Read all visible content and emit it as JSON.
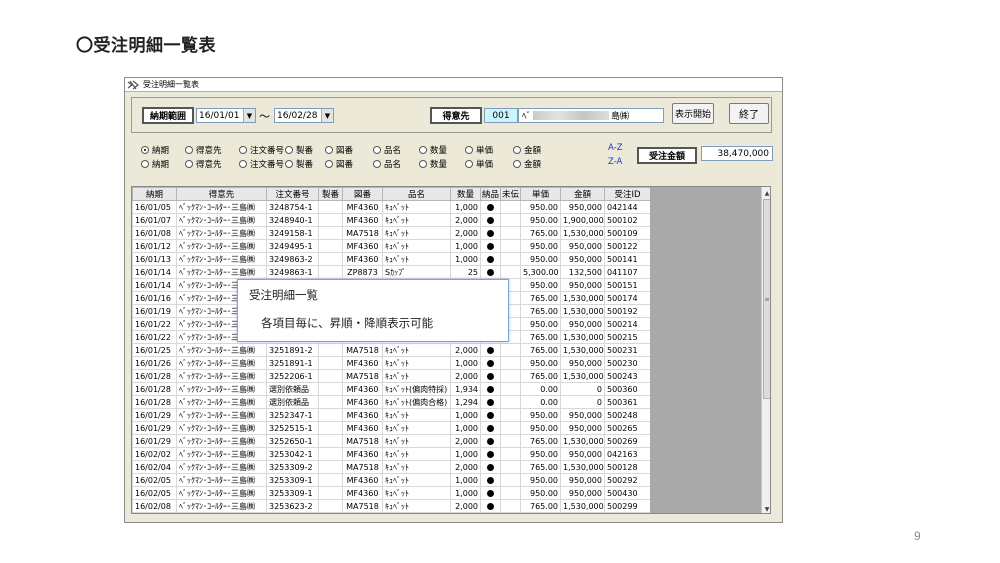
{
  "page": {
    "title": "〇受注明細一覧表",
    "page_number": "9"
  },
  "window": {
    "title": "受注明細一覧表"
  },
  "filter": {
    "period_label": "納期範囲",
    "date_from": "16/01/01",
    "tilde": "～",
    "date_to": "16/02/28",
    "customer_label": "得意先",
    "customer_code": "001",
    "customer_name_prefix": "ﾍﾞ",
    "customer_name_suffix": "島㈱",
    "show_button": "表示開始",
    "exit_button": "終了"
  },
  "sort": {
    "row1": [
      "納期",
      "得意先",
      "注文番号",
      "製番",
      "図番",
      "品名",
      "数量",
      "単価",
      "金額"
    ],
    "row2": [
      "納期",
      "得意先",
      "注文番号",
      "製番",
      "図番",
      "品名",
      "数量",
      "単価",
      "金額"
    ],
    "asc": "A-Z",
    "desc": "Z-A"
  },
  "total": {
    "label": "受注金額",
    "value": "38,470,000"
  },
  "grid": {
    "columns": [
      "納期",
      "得意先",
      "注文番号",
      "製番",
      "図番",
      "品名",
      "数量",
      "納品",
      "未伝",
      "単価",
      "金額",
      "受注ID"
    ],
    "rows": [
      [
        "16/01/05",
        "ﾍﾞｯｸﾏﾝ･ｺｰﾙﾀｰ･三島㈱",
        "3248754-1",
        "",
        "MF4360",
        "ｷｭﾍﾞｯﾄ",
        "1,000",
        "●",
        "",
        "950.00",
        "950,000",
        "042144"
      ],
      [
        "16/01/07",
        "ﾍﾞｯｸﾏﾝ･ｺｰﾙﾀｰ･三島㈱",
        "3248940-1",
        "",
        "MF4360",
        "ｷｭﾍﾞｯﾄ",
        "2,000",
        "●",
        "",
        "950.00",
        "1,900,000",
        "500102"
      ],
      [
        "16/01/08",
        "ﾍﾞｯｸﾏﾝ･ｺｰﾙﾀｰ･三島㈱",
        "3249158-1",
        "",
        "MA7518",
        "ｷｭﾍﾞｯﾄ",
        "2,000",
        "●",
        "",
        "765.00",
        "1,530,000",
        "500109"
      ],
      [
        "16/01/12",
        "ﾍﾞｯｸﾏﾝ･ｺｰﾙﾀｰ･三島㈱",
        "3249495-1",
        "",
        "MF4360",
        "ｷｭﾍﾞｯﾄ",
        "1,000",
        "●",
        "",
        "950.00",
        "950,000",
        "500122"
      ],
      [
        "16/01/13",
        "ﾍﾞｯｸﾏﾝ･ｺｰﾙﾀｰ･三島㈱",
        "3249863-2",
        "",
        "MF4360",
        "ｷｭﾍﾞｯﾄ",
        "1,000",
        "●",
        "",
        "950.00",
        "950,000",
        "500141"
      ],
      [
        "16/01/14",
        "ﾍﾞｯｸﾏﾝ･ｺｰﾙﾀｰ･三島㈱",
        "3249863-1",
        "",
        "ZP8873",
        "Sｶｯﾌﾟ",
        "25",
        "●",
        "",
        "5,300.00",
        "132,500",
        "041107"
      ],
      [
        "16/01/14",
        "ﾍﾞｯｸﾏﾝ･ｺｰﾙﾀｰ･三",
        "",
        "",
        "",
        "",
        "",
        "",
        "",
        "950.00",
        "950,000",
        "500151"
      ],
      [
        "16/01/16",
        "ﾍﾞｯｸﾏﾝ･ｺｰﾙﾀｰ･三",
        "",
        "",
        "",
        "",
        "",
        "",
        "",
        "765.00",
        "1,530,000",
        "500174"
      ],
      [
        "16/01/19",
        "ﾍﾞｯｸﾏﾝ･ｺｰﾙﾀｰ･三",
        "",
        "",
        "",
        "",
        "",
        "",
        "",
        "765.00",
        "1,530,000",
        "500192"
      ],
      [
        "16/01/22",
        "ﾍﾞｯｸﾏﾝ･ｺｰﾙﾀｰ･三",
        "",
        "",
        "",
        "",
        "",
        "",
        "",
        "950.00",
        "950,000",
        "500214"
      ],
      [
        "16/01/22",
        "ﾍﾞｯｸﾏﾝ･ｺｰﾙﾀｰ･三",
        "",
        "",
        "",
        "",
        "",
        "",
        "",
        "765.00",
        "1,530,000",
        "500215"
      ],
      [
        "16/01/25",
        "ﾍﾞｯｸﾏﾝ･ｺｰﾙﾀｰ･三島㈱",
        "3251891-2",
        "",
        "MA7518",
        "ｷｭﾍﾞｯﾄ",
        "2,000",
        "●",
        "",
        "765.00",
        "1,530,000",
        "500231"
      ],
      [
        "16/01/26",
        "ﾍﾞｯｸﾏﾝ･ｺｰﾙﾀｰ･三島㈱",
        "3251891-1",
        "",
        "MF4360",
        "ｷｭﾍﾞｯﾄ",
        "1,000",
        "●",
        "",
        "950.00",
        "950,000",
        "500230"
      ],
      [
        "16/01/28",
        "ﾍﾞｯｸﾏﾝ･ｺｰﾙﾀｰ･三島㈱",
        "3252206-1",
        "",
        "MA7518",
        "ｷｭﾍﾞｯﾄ",
        "2,000",
        "●",
        "",
        "765.00",
        "1,530,000",
        "500243"
      ],
      [
        "16/01/28",
        "ﾍﾞｯｸﾏﾝ･ｺｰﾙﾀｰ･三島㈱",
        "選別依頼品",
        "",
        "MF4360",
        "ｷｭﾍﾞｯﾄ(偏肉特採)",
        "1,934",
        "●",
        "",
        "0.00",
        "0",
        "500360"
      ],
      [
        "16/01/28",
        "ﾍﾞｯｸﾏﾝ･ｺｰﾙﾀｰ･三島㈱",
        "選別依頼品",
        "",
        "MF4360",
        "ｷｭﾍﾞｯﾄ(偏肉合格)",
        "1,294",
        "●",
        "",
        "0.00",
        "0",
        "500361"
      ],
      [
        "16/01/29",
        "ﾍﾞｯｸﾏﾝ･ｺｰﾙﾀｰ･三島㈱",
        "3252347-1",
        "",
        "MF4360",
        "ｷｭﾍﾞｯﾄ",
        "1,000",
        "●",
        "",
        "950.00",
        "950,000",
        "500248"
      ],
      [
        "16/01/29",
        "ﾍﾞｯｸﾏﾝ･ｺｰﾙﾀｰ･三島㈱",
        "3252515-1",
        "",
        "MF4360",
        "ｷｭﾍﾞｯﾄ",
        "1,000",
        "●",
        "",
        "950.00",
        "950,000",
        "500265"
      ],
      [
        "16/01/29",
        "ﾍﾞｯｸﾏﾝ･ｺｰﾙﾀｰ･三島㈱",
        "3252650-1",
        "",
        "MA7518",
        "ｷｭﾍﾞｯﾄ",
        "2,000",
        "●",
        "",
        "765.00",
        "1,530,000",
        "500269"
      ],
      [
        "16/02/02",
        "ﾍﾞｯｸﾏﾝ･ｺｰﾙﾀｰ･三島㈱",
        "3253042-1",
        "",
        "MF4360",
        "ｷｭﾍﾞｯﾄ",
        "1,000",
        "●",
        "",
        "950.00",
        "950,000",
        "042163"
      ],
      [
        "16/02/04",
        "ﾍﾞｯｸﾏﾝ･ｺｰﾙﾀｰ･三島㈱",
        "3253309-2",
        "",
        "MA7518",
        "ｷｭﾍﾞｯﾄ",
        "2,000",
        "●",
        "",
        "765.00",
        "1,530,000",
        "500128"
      ],
      [
        "16/02/05",
        "ﾍﾞｯｸﾏﾝ･ｺｰﾙﾀｰ･三島㈱",
        "3253309-1",
        "",
        "MF4360",
        "ｷｭﾍﾞｯﾄ",
        "1,000",
        "●",
        "",
        "950.00",
        "950,000",
        "500292"
      ],
      [
        "16/02/05",
        "ﾍﾞｯｸﾏﾝ･ｺｰﾙﾀｰ･三島㈱",
        "3253309-1",
        "",
        "MF4360",
        "ｷｭﾍﾞｯﾄ",
        "1,000",
        "●",
        "",
        "950.00",
        "950,000",
        "500430"
      ],
      [
        "16/02/08",
        "ﾍﾞｯｸﾏﾝ･ｺｰﾙﾀｰ･三島㈱",
        "3253623-2",
        "",
        "MA7518",
        "ｷｭﾍﾞｯﾄ",
        "2,000",
        "●",
        "",
        "765.00",
        "1,530,000",
        "500299"
      ]
    ]
  },
  "callout": {
    "title": "受注明細一覧",
    "body": "各項目毎に、昇順・降順表示可能"
  },
  "colors": {
    "code_field": "#ccf4ff",
    "sort_link": "#2233cc",
    "grey_pane": "#a9a9a9"
  }
}
